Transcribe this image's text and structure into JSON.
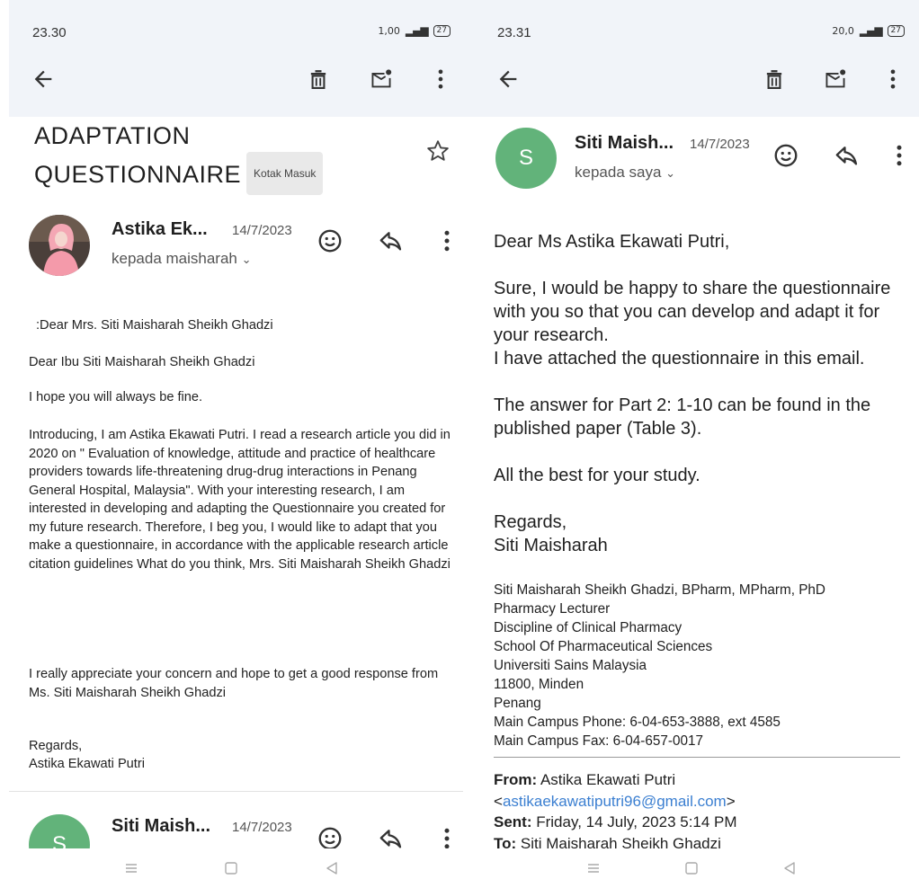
{
  "left": {
    "status": {
      "time": "23.30",
      "speed": "1,00",
      "battery": "27"
    },
    "subject": {
      "line1": "ADAPTATION",
      "line2": "QUESTIONNAIRE",
      "label": "Kotak Masuk"
    },
    "message": {
      "sender": "Astika Ek...",
      "date": "14/7/2023",
      "recipient": "kepada maisharah",
      "paragraphs": [
        ":Dear Mrs. Siti Maisharah Sheikh Ghadzi",
        "Dear Ibu Siti Maisharah Sheikh Ghadzi",
        "I hope you will always be fine.",
        "Introducing, I am Astika Ekawati Putri. I read a research article you did in 2020 on \" Evaluation of knowledge, attitude and practice of healthcare providers towards life-threatening drug-drug interactions in Penang General Hospital, Malaysia\". With your interesting research, I am interested in developing and adapting the Questionnaire you created for my future research. Therefore, I beg you, I would like to adapt that you make a questionnaire, in accordance with the applicable research article citation guidelines What do you think, Mrs. Siti Maisharah Sheikh Ghadzi",
        "I really appreciate your concern and hope to get a good response from Ms. Siti Maisharah Sheikh Ghadzi",
        "Regards,",
        "Astika Ekawati Putri"
      ]
    },
    "next_message": {
      "avatar_letter": "S",
      "sender": "Siti Maish...",
      "date": "14/7/2023"
    }
  },
  "right": {
    "status": {
      "time": "23.31",
      "speed": "20,0",
      "battery": "27"
    },
    "message": {
      "avatar_letter": "S",
      "sender": "Siti Maish...",
      "date": "14/7/2023",
      "recipient": "kepada saya",
      "greeting": "Dear Ms Astika Ekawati Putri,",
      "body": [
        "Sure, I would be happy to share the questionnaire with you so that you can develop and adapt it for your research.",
        "I have attached the questionnaire in this email.",
        "The answer for Part 2: 1-10 can be found in the published paper (Table 3)."
      ],
      "closing": "All the best for your study.",
      "regards": "Regards,",
      "name": "Siti Maisharah",
      "signature": [
        "Siti Maisharah Sheikh Ghadzi, BPharm, MPharm, PhD",
        "Pharmacy Lecturer",
        "Discipline of Clinical Pharmacy",
        "School Of Pharmaceutical Sciences",
        "Universiti Sains Malaysia",
        "11800, Minden",
        "Penang",
        "Main Campus Phone: 6-04-653-3888, ext 4585",
        "Main Campus Fax: 6-04-657-0017"
      ],
      "quoted": {
        "from_label": "From:",
        "from_value": "Astika Ekawati Putri",
        "email_open": "<",
        "email": "astikaekawatiputri96@gmail.com",
        "email_close": ">",
        "sent_label": "Sent:",
        "sent_value": "Friday, 14 July, 2023 5:14 PM",
        "to_label": "To:",
        "to_value": "Siti Maisharah Sheikh Ghadzi"
      }
    }
  }
}
